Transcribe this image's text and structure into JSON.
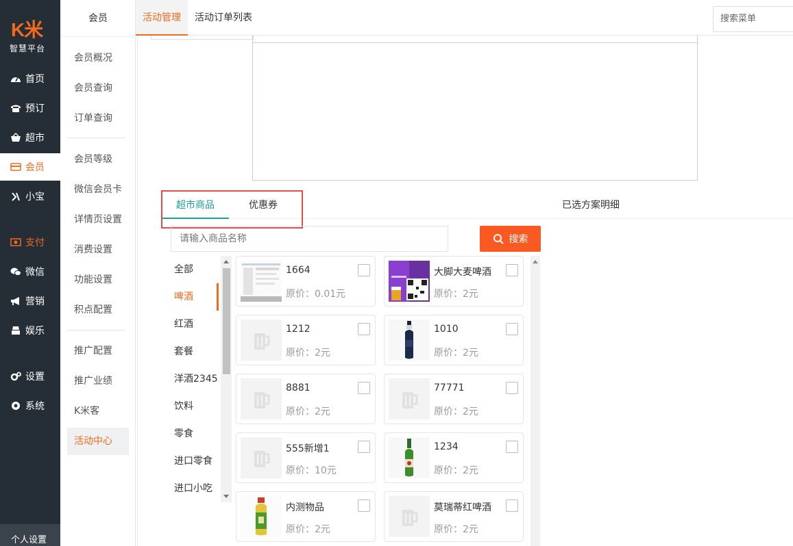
{
  "logo": {
    "mark": "K米",
    "text": "智慧平台"
  },
  "leftnav": [
    {
      "label": "首页",
      "icon": "dashboard-icon",
      "active": false
    },
    {
      "label": "预订",
      "icon": "phone-icon",
      "active": false
    },
    {
      "label": "超市",
      "icon": "basket-icon",
      "active": false
    },
    {
      "label": "会员",
      "icon": "card-icon",
      "active": true
    },
    {
      "label": "小宝",
      "icon": "xiaobao-icon",
      "active": false
    },
    {
      "label": "支付",
      "icon": "payment-icon",
      "active": false
    },
    {
      "label": "微信",
      "icon": "wechat-icon",
      "active": false
    },
    {
      "label": "营销",
      "icon": "megaphone-icon",
      "active": false
    },
    {
      "label": "娱乐",
      "icon": "entertainment-icon",
      "active": false
    },
    {
      "label": "设置",
      "icon": "gears-icon",
      "active": false
    },
    {
      "label": "系统",
      "icon": "system-icon",
      "active": false
    }
  ],
  "leftnav_bottom": "个人设置",
  "submenu": {
    "title": "会员",
    "items": [
      "会员概况",
      "会员查询",
      "订单查询",
      "会员等级",
      "微信会员卡",
      "详情页设置",
      "消费设置",
      "功能设置",
      "积点配置",
      "推广配置",
      "推广业绩",
      "K米客",
      "活动中心"
    ],
    "active_index": 12
  },
  "topbar": {
    "tabs": [
      "活动管理",
      "活动订单列表"
    ],
    "active_tab": 0,
    "search_placeholder": "搜索菜单"
  },
  "main": {
    "tabs": [
      "超市商品",
      "优惠券"
    ],
    "selected_title": "已选方案明细",
    "search_placeholder": "请输入商品名称",
    "search_button": "搜索",
    "categories": [
      "全部",
      "啤酒",
      "红酒",
      "套餐",
      "洋酒2345",
      "饮料",
      "零食",
      "进口零食",
      "进口小吃"
    ],
    "active_category": 1,
    "products": [
      {
        "name": "1664",
        "price": "原价：0.01元",
        "image": "screenshot-thumb"
      },
      {
        "name": "大脚大麦啤酒",
        "price": "原价：2元",
        "image": "promo-qr-thumb"
      },
      {
        "name": "1212",
        "price": "原价：2元",
        "image": "placeholder-beer"
      },
      {
        "name": "1010",
        "price": "原价：2元",
        "image": "dark-bottle"
      },
      {
        "name": "8881",
        "price": "原价：2元",
        "image": "placeholder-beer"
      },
      {
        "name": "77771",
        "price": "原价：2元",
        "image": "placeholder-beer"
      },
      {
        "name": "555新增1",
        "price": "原价：10元",
        "image": "placeholder-beer"
      },
      {
        "name": "1234",
        "price": "原价：2元",
        "image": "green-bottle"
      },
      {
        "name": "内测物品",
        "price": "原价：2元",
        "image": "tea-bottle"
      },
      {
        "name": "莫瑞蒂红啤酒",
        "price": "原价：2元",
        "image": "placeholder-beer"
      }
    ]
  },
  "colors": {
    "accent": "#f26a1b",
    "nav_bg": "#252d36",
    "tab_green": "#1aa094",
    "search_btn": "#fa5a22",
    "highlight": "#e54b4b"
  }
}
